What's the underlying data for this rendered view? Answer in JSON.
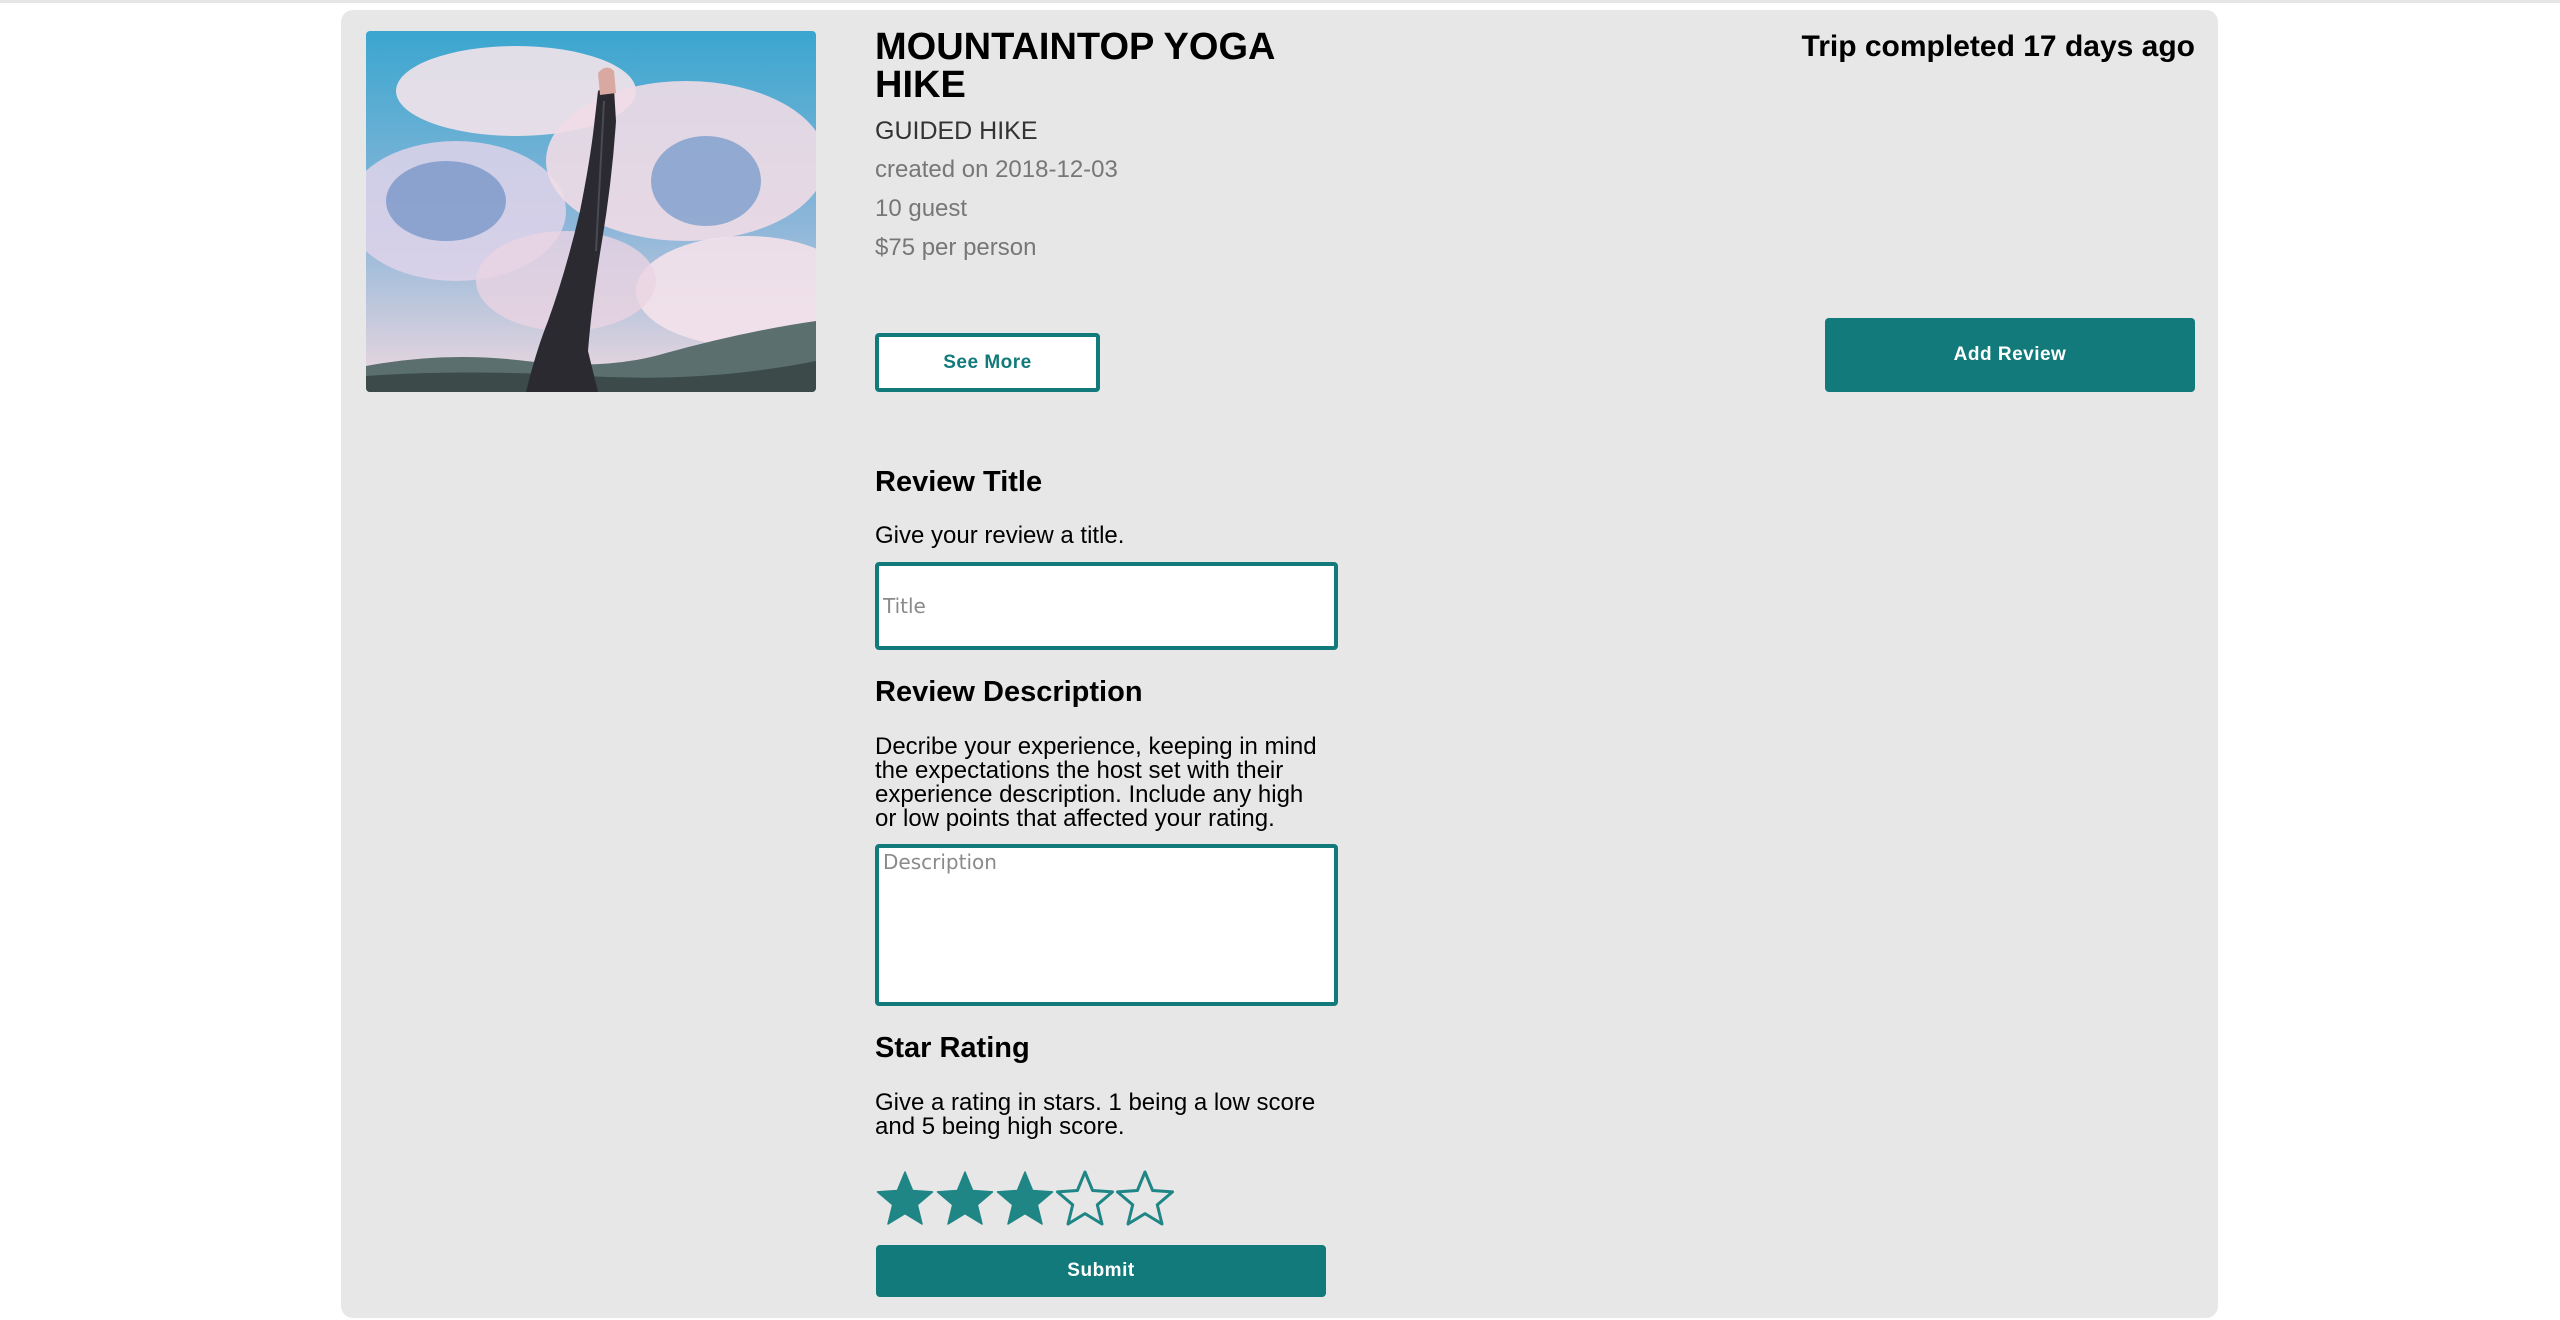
{
  "trip": {
    "title": "MOUNTAINTOP YOGA HIKE",
    "type": "GUIDED HIKE",
    "created": "created on 2018-12-03",
    "guests": "10 guest",
    "price": "$75 per person",
    "status": "Trip completed 17 days ago",
    "image_description": "photo-yoga-legs-against-sky"
  },
  "actions": {
    "see_more_label": "See More",
    "add_review_label": "Add Review",
    "submit_label": "Submit"
  },
  "review_form": {
    "title_heading": "Review Title",
    "title_help": "Give your review a title.",
    "title_placeholder": "Title",
    "title_value": "",
    "description_heading": "Review Description",
    "description_help": "Decribe your experience, keeping in mind the expectations the host set with their experience description. Include any high or low points that affected your rating.",
    "description_placeholder": "Description",
    "description_value": "",
    "rating_heading": "Star Rating",
    "rating_help": "Give a rating in stars. 1 being a low score and 5 being high score.",
    "rating_value": 3,
    "rating_max": 5,
    "star_icon": "star-icon"
  },
  "colors": {
    "accent": "#127a7a",
    "card_background": "#e7e7e7",
    "star_fill": "#1f8585"
  }
}
